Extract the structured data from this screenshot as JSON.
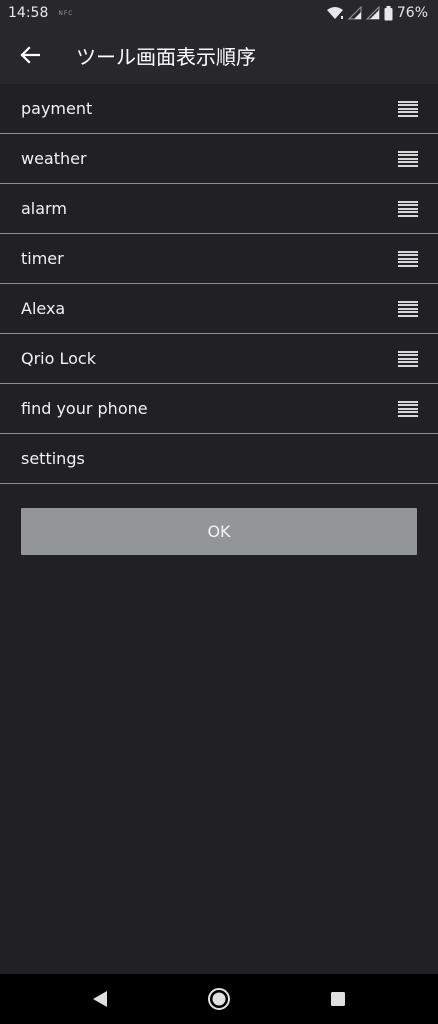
{
  "status_bar": {
    "time": "14:58",
    "note": "NFC",
    "battery": "76%",
    "icons": [
      "wifi-icon",
      "signal-icon",
      "signal-icon",
      "battery-icon"
    ]
  },
  "app_bar": {
    "back_icon": "arrow-back-icon",
    "title": "ツール画面表示順序"
  },
  "tools": [
    {
      "label": "payment",
      "draggable": true
    },
    {
      "label": "weather",
      "draggable": true
    },
    {
      "label": "alarm",
      "draggable": true
    },
    {
      "label": "timer",
      "draggable": true
    },
    {
      "label": "Alexa",
      "draggable": true
    },
    {
      "label": "Qrio Lock",
      "draggable": true
    },
    {
      "label": "find your phone",
      "draggable": true
    },
    {
      "label": "settings",
      "draggable": false
    }
  ],
  "ok_button": {
    "label": "OK"
  },
  "nav_bar": {
    "icons": [
      "back-triangle-icon",
      "home-circle-icon",
      "recents-square-icon"
    ]
  },
  "colors": {
    "background": "#202025",
    "app_bar": "#27272c",
    "divider": "#8e8e92",
    "ok_button": "#939699"
  }
}
